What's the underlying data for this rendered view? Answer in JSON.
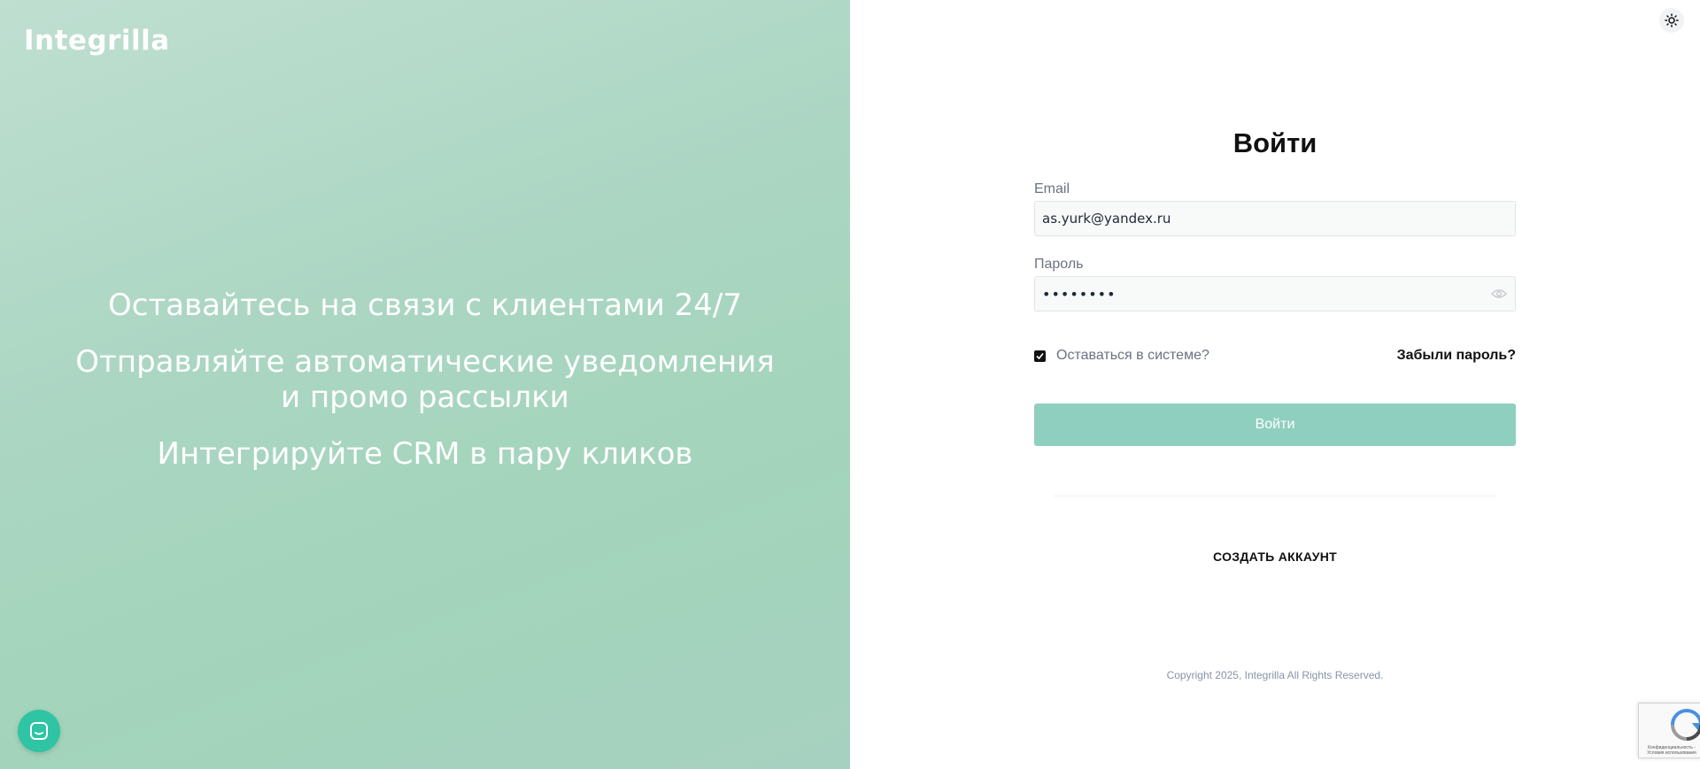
{
  "brand": {
    "logo_text": "Integrilla"
  },
  "promo": {
    "lines": [
      "Оставайтесь на связи с клиентами 24/7",
      "Отправляйте автоматические уведомления и промо рассылки",
      "Интегрируйте CRM в пару кликов"
    ]
  },
  "login": {
    "title": "Войти",
    "email_label": "Email",
    "email_value": "as.yurk@yandex.ru",
    "password_label": "Пароль",
    "password_value": "********",
    "remember_label": "Оставаться в системе?",
    "remember_checked": true,
    "forgot_link": "Забыли пароль?",
    "submit_label": "Войти",
    "create_account_label": "СОЗДАТЬ АККАУНТ",
    "copyright": "Copyright 2025, Integrilla All Rights Reserved."
  },
  "recaptcha": {
    "text": "Конфиденциальность - Условия использования"
  },
  "icons": {
    "theme_toggle": "sun-icon",
    "password_visibility": "eye-icon",
    "chat": "chat-icon",
    "checkbox": "check-icon"
  },
  "colors": {
    "brand_green": "#8fcfbf",
    "chat_button": "#2ec4a4",
    "panel_gradient_start": "#bfdfd1",
    "panel_gradient_end": "#a3d4bb"
  }
}
